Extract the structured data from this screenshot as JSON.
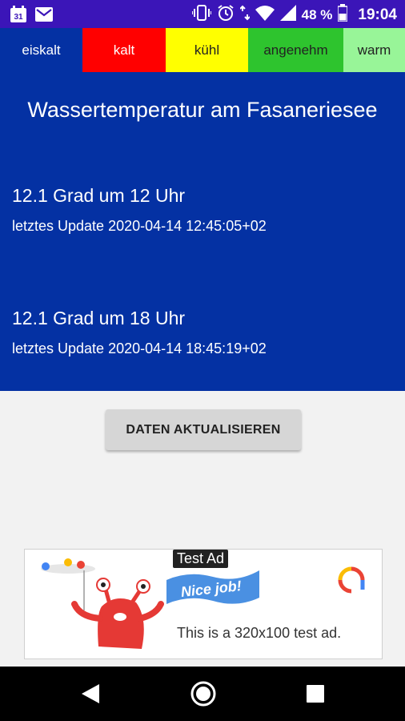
{
  "status_bar": {
    "calendar_day": "31",
    "battery_percent": "48 %",
    "time": "19:04"
  },
  "tabs": [
    {
      "label": "eiskalt",
      "color": "#0431a3"
    },
    {
      "label": "kalt",
      "color": "#ff0000"
    },
    {
      "label": "kühl",
      "color": "#ffff00"
    },
    {
      "label": "angenehm",
      "color": "#2ec42e"
    },
    {
      "label": "warm",
      "color": "#98f598"
    }
  ],
  "main": {
    "title": "Wassertemperatur am Fasaneriesee",
    "readings": [
      {
        "value": "12.1 Grad um 12 Uhr",
        "update": "letztes Update 2020-04-14 12:45:05+02"
      },
      {
        "value": "12.1 Grad um 18 Uhr",
        "update": "letztes Update 2020-04-14 18:45:19+02"
      }
    ]
  },
  "refresh_button": {
    "label": "DATEN AKTUALISIEREN"
  },
  "ad": {
    "label": "Test Ad",
    "banner": "Nice job!",
    "text": "This is a 320x100 test ad."
  }
}
